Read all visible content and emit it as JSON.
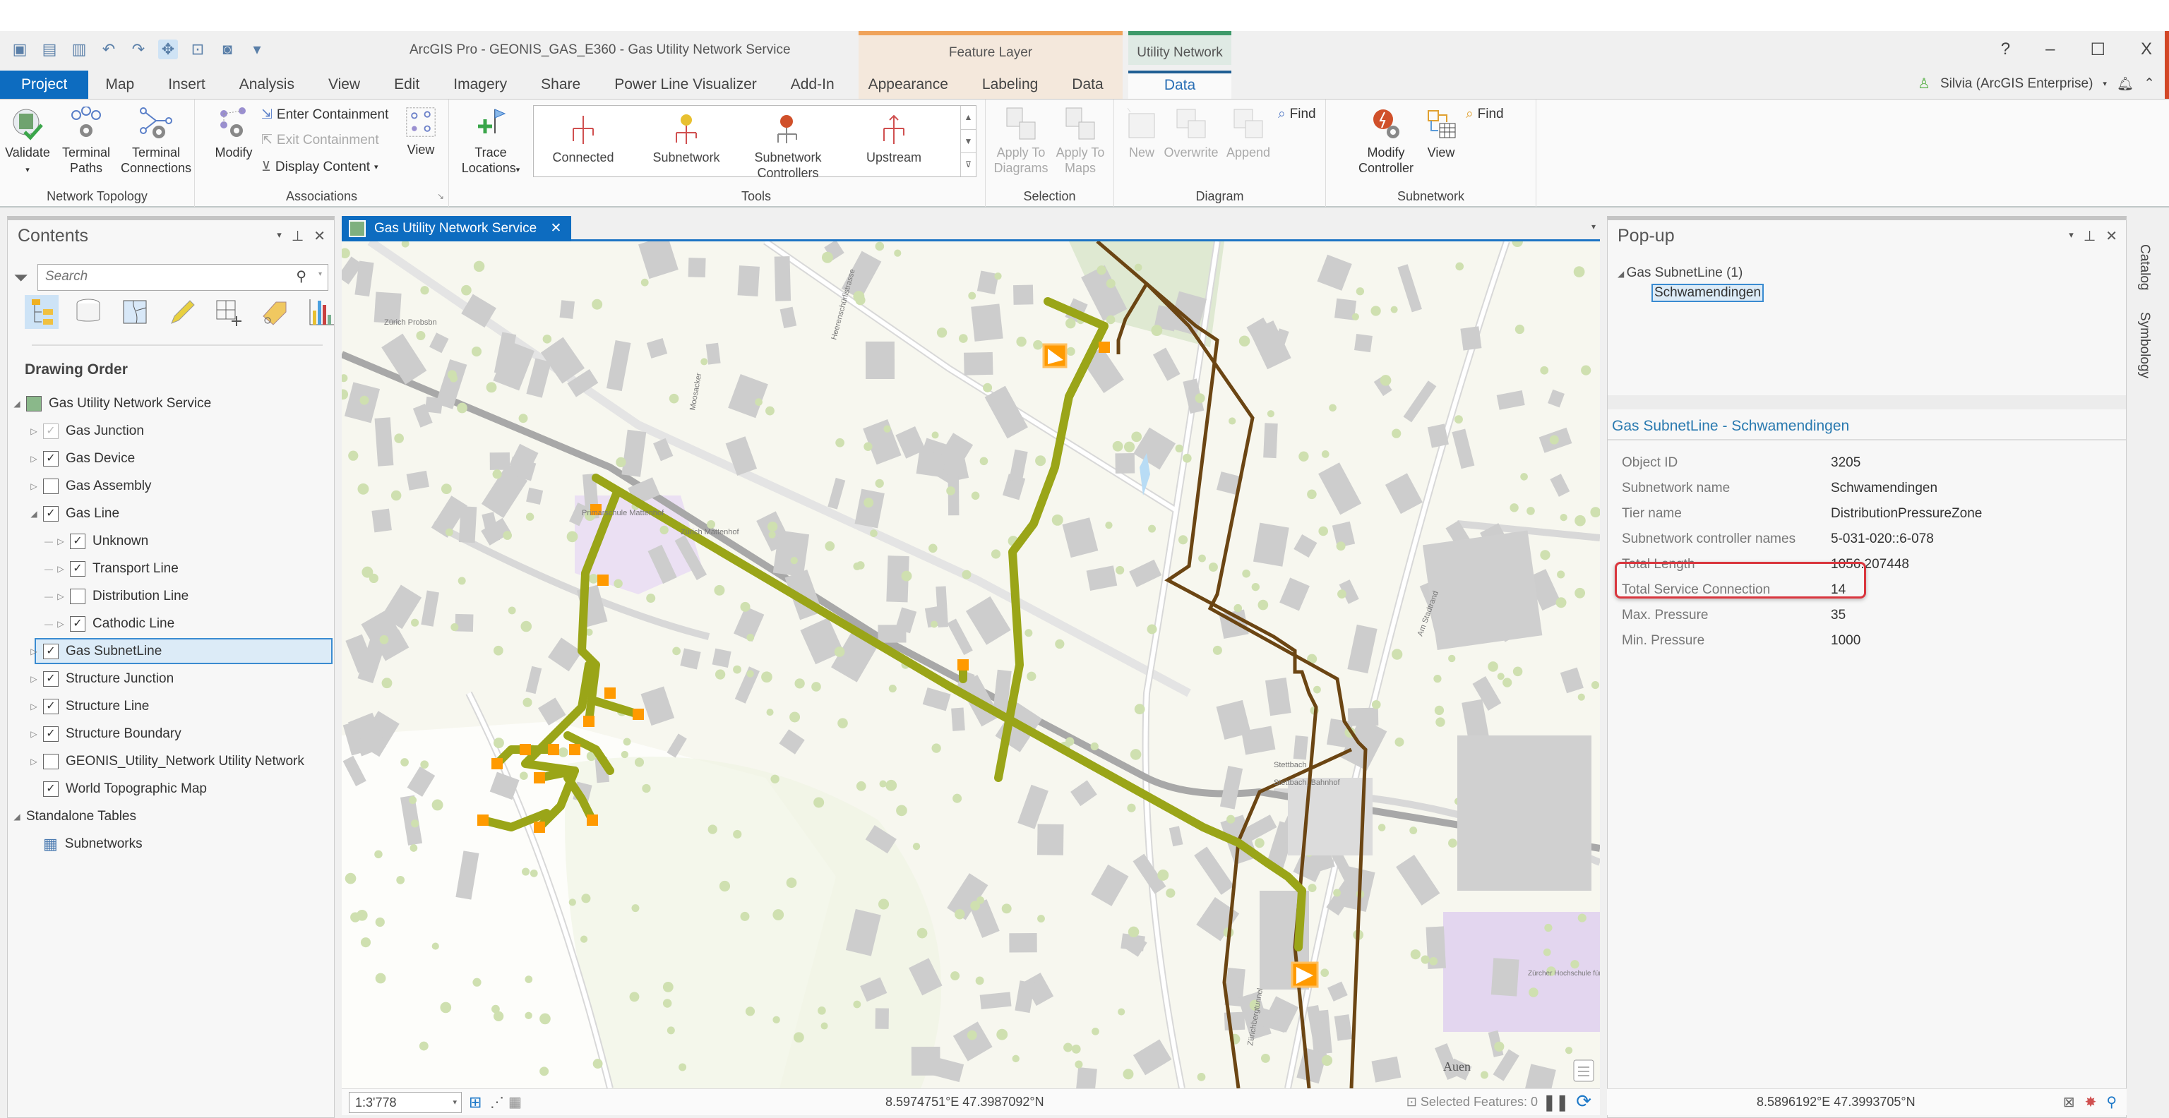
{
  "window": {
    "title": "ArcGIS Pro - GEONIS_GAS_E360 - Gas Utility Network Service",
    "controls": {
      "help": "?",
      "minimize": "–",
      "maximize": "☐",
      "close": "X"
    },
    "contextual_groups": {
      "feature_layer": "Feature Layer",
      "utility_network": "Utility Network"
    },
    "user": "Silvia (ArcGIS Enterprise)"
  },
  "tabs": [
    {
      "label": "Project"
    },
    {
      "label": "Map"
    },
    {
      "label": "Insert"
    },
    {
      "label": "Analysis"
    },
    {
      "label": "View"
    },
    {
      "label": "Edit"
    },
    {
      "label": "Imagery"
    },
    {
      "label": "Share"
    },
    {
      "label": "Power Line Visualizer"
    },
    {
      "label": "Add-In"
    },
    {
      "label": "Appearance"
    },
    {
      "label": "Labeling"
    },
    {
      "label": "Data"
    },
    {
      "label": "Data"
    }
  ],
  "ribbon": {
    "network_topology": {
      "label": "Network Topology",
      "validate": "Validate",
      "terminal_paths": [
        "Terminal",
        "Paths"
      ],
      "terminal_connections": [
        "Terminal",
        "Connections"
      ]
    },
    "associations": {
      "label": "Associations",
      "modify": "Modify",
      "enter_containment": "Enter Containment",
      "exit_containment": "Exit Containment",
      "display_content": "Display Content",
      "view": "View"
    },
    "trace": {
      "trace_locations": [
        "Trace",
        "Locations"
      ]
    },
    "tools": {
      "label": "Tools",
      "connected": "Connected",
      "subnetwork": "Subnetwork",
      "subnetwork_controllers": [
        "Subnetwork",
        "Controllers"
      ],
      "upstream": "Upstream"
    },
    "selection": {
      "label": "Selection",
      "apply_to_diagrams": [
        "Apply To",
        "Diagrams"
      ],
      "apply_to_maps": [
        "Apply To",
        "Maps"
      ]
    },
    "diagram": {
      "label": "Diagram",
      "new": "New",
      "overwrite": "Overwrite",
      "append": "Append",
      "find": "Find"
    },
    "subnetwork": {
      "label": "Subnetwork",
      "modify_controller": [
        "Modify",
        "Controller"
      ],
      "view": "View",
      "find": "Find"
    }
  },
  "contents": {
    "title": "Contents",
    "search_placeholder": "Search",
    "section": "Drawing Order",
    "layers": [
      {
        "name": "Gas Utility Network Service",
        "level": 0,
        "expander": "open",
        "checkbox": "map"
      },
      {
        "name": "Gas Junction",
        "level": 1,
        "expander": "closed",
        "checked": true,
        "dim": true
      },
      {
        "name": "Gas Device",
        "level": 1,
        "expander": "closed",
        "checked": true
      },
      {
        "name": "Gas Assembly",
        "level": 1,
        "expander": "closed",
        "checked": false
      },
      {
        "name": "Gas Line",
        "level": 1,
        "expander": "open",
        "checked": true
      },
      {
        "name": "Unknown",
        "level": 2,
        "expander": "closed",
        "checked": true
      },
      {
        "name": "Transport Line",
        "level": 2,
        "expander": "closed",
        "checked": true
      },
      {
        "name": "Distribution Line",
        "level": 2,
        "expander": "closed",
        "checked": false
      },
      {
        "name": "Cathodic Line",
        "level": 2,
        "expander": "closed",
        "checked": true
      },
      {
        "name": "Gas SubnetLine",
        "level": 1,
        "expander": "closed",
        "checked": true,
        "selected": true
      },
      {
        "name": "Structure Junction",
        "level": 1,
        "expander": "closed",
        "checked": true
      },
      {
        "name": "Structure Line",
        "level": 1,
        "expander": "closed",
        "checked": true
      },
      {
        "name": "Structure Boundary",
        "level": 1,
        "expander": "closed",
        "checked": true
      },
      {
        "name": "GEONIS_Utility_Network Utility Network",
        "level": 1,
        "expander": "closed",
        "checked": false
      },
      {
        "name": "World Topographic Map",
        "level": 1,
        "expander": "none",
        "checked": true
      },
      {
        "name": "Standalone Tables",
        "level": 0,
        "expander": "open",
        "checkbox": "none"
      },
      {
        "name": "Subnetworks",
        "level": 1,
        "expander": "none",
        "checkbox": "table"
      }
    ]
  },
  "map": {
    "tab_label": "Gas Utility Network Service",
    "scale": "1:3'778",
    "coordinates": "8.5974751°E 47.3987092°N",
    "selected_features": "Selected Features: 0",
    "labels": [
      "Zürich Probsbn",
      "Primarschule Mattenhof",
      "Zürich Mattenhof",
      "Stettbach",
      "Stettbach, Bahnhof",
      "Zürcher Hochschule für Angewandte Wissenschaften ZHAW",
      "Auen",
      "Am Stadtrand",
      "Moosacker",
      "Heerenschürlistrasse",
      "Zürichbergtunnel"
    ],
    "colors": {
      "subnet_line": "#9aa518",
      "cathodic_line": "#6b4513",
      "device": "#ff9a00",
      "rail": "#a8a8a8"
    }
  },
  "popup": {
    "title": "Pop-up",
    "group": "Gas SubnetLine  (1)",
    "item": "Schwamendingen",
    "feature_title": "Gas SubnetLine - Schwamendingen",
    "attributes": [
      {
        "key": "Object ID",
        "value": "3205"
      },
      {
        "key": "Subnetwork name",
        "value": "Schwamendingen"
      },
      {
        "key": "Tier name",
        "value": "DistributionPressureZone"
      },
      {
        "key": "Subnetwork controller names",
        "value": "5-031-020::6-078"
      },
      {
        "key": "Total Length",
        "value": "1056.207448"
      },
      {
        "key": "Total Service Connection",
        "value": "14",
        "highlighted": true
      },
      {
        "key": "Max. Pressure",
        "value": "35"
      },
      {
        "key": "Min. Pressure",
        "value": "1000"
      }
    ],
    "coordinates": "8.5896192°E 47.3993705°N"
  },
  "side_tabs": [
    "Catalog",
    "Symbology"
  ]
}
